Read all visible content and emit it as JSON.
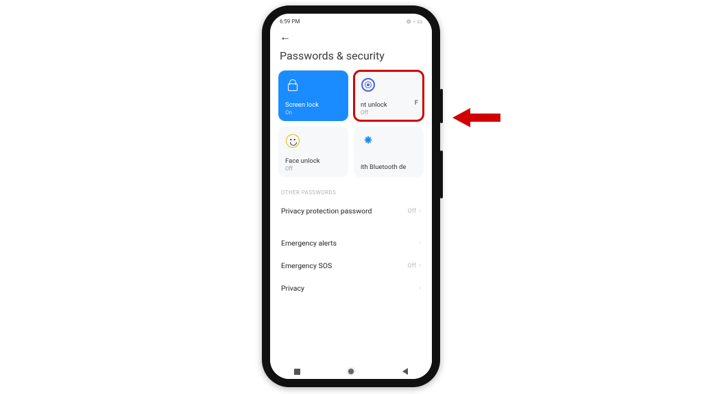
{
  "statusbar": {
    "time": "6:59 PM"
  },
  "header": {
    "title": "Passwords & security"
  },
  "cards": {
    "screen_lock": {
      "label": "Screen lock",
      "status": "On"
    },
    "fingerprint": {
      "label": "nt unlock",
      "extra": "F",
      "status": "Off"
    },
    "face": {
      "label": "Face unlock",
      "status": "Off"
    },
    "bluetooth": {
      "label": "ith Bluetooth de",
      "status": ""
    }
  },
  "sections": {
    "other_passwords": "OTHER PASSWORDS"
  },
  "list": {
    "privacy_protection": {
      "label": "Privacy protection password",
      "status": "Off"
    },
    "emergency_alerts": {
      "label": "Emergency alerts",
      "status": ""
    },
    "emergency_sos": {
      "label": "Emergency SOS",
      "status": "Off"
    },
    "privacy": {
      "label": "Privacy",
      "status": ""
    }
  }
}
